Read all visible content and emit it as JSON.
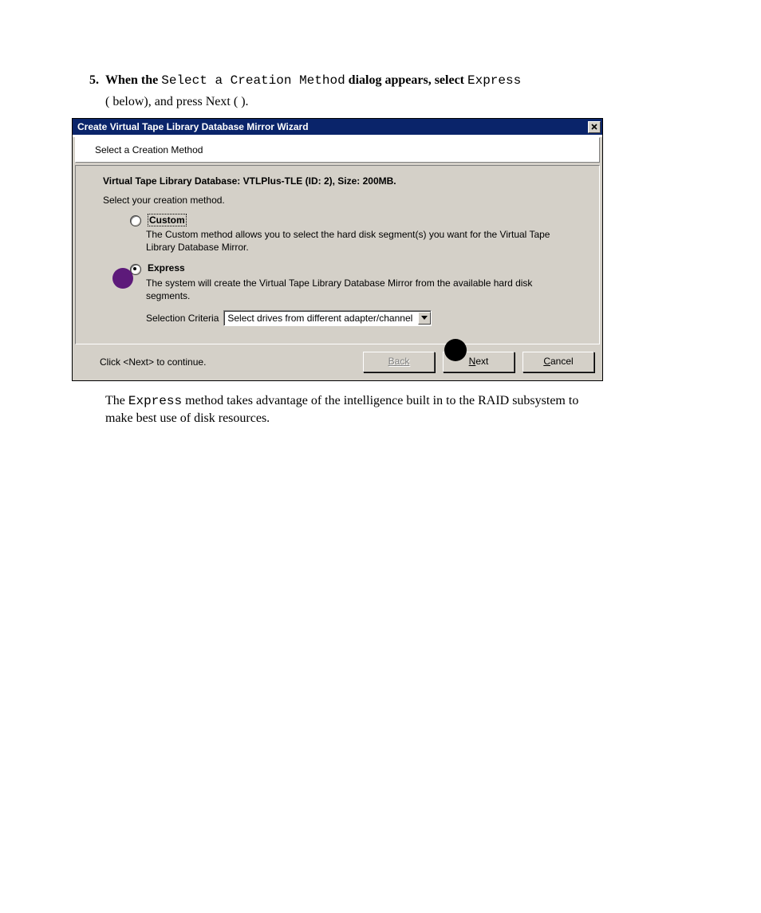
{
  "step": {
    "number": "5.",
    "line1_a": "When the ",
    "line1_b": "Select a Creation Method",
    "line1_c": " dialog appears, select ",
    "line1_d": "Express",
    "line2_a": "(",
    "line2_b": "   below), and press ",
    "line2_c": "Next",
    "line2_d": " (   )."
  },
  "dialog": {
    "title": "Create Virtual Tape Library Database Mirror Wizard",
    "close_glyph": "✕",
    "sub_header": "Select a Creation Method",
    "panel_heading": "Virtual Tape Library Database: VTLPlus-TLE (ID: 2), Size: 200MB.",
    "instruction": "Select your creation method.",
    "options": {
      "custom": {
        "label": "Custom",
        "desc": "The Custom method allows you to select the hard disk segment(s) you want for the Virtual Tape Library Database Mirror."
      },
      "express": {
        "label": "Express",
        "desc": "The system will create the Virtual Tape Library Database Mirror from the available hard disk segments."
      }
    },
    "criteria_label": "Selection Criteria",
    "criteria_value": "Select drives from different adapter/channel",
    "footer_text": "Click <Next> to continue.",
    "buttons": {
      "back_pre": "B",
      "back_post": "ack",
      "next_pre": "N",
      "next_post": "ext",
      "cancel_pre": "C",
      "cancel_post": "ancel"
    }
  },
  "after": {
    "t1": "The ",
    "t2": "Express",
    "t3": " method takes advantage of the intelligence built in to the RAID subsystem to make best use of disk resources."
  }
}
